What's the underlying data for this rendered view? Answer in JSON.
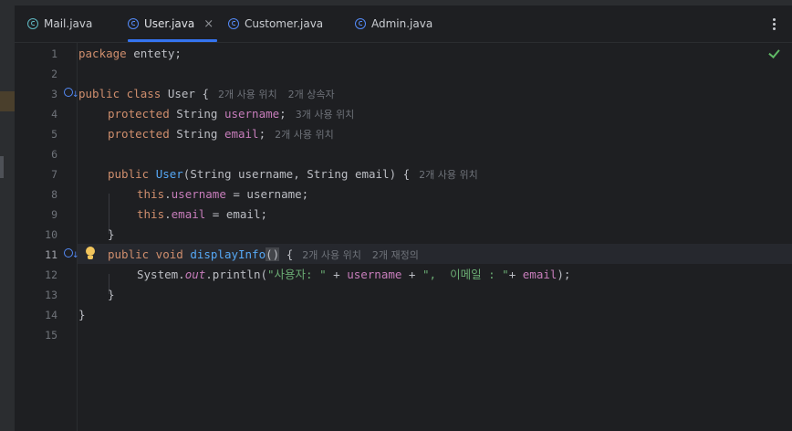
{
  "tabs": [
    {
      "label": "Mail.java",
      "icon": "interface-icon"
    },
    {
      "label": "User.java",
      "icon": "class-icon",
      "active": true,
      "close": "×"
    },
    {
      "label": "Customer.java",
      "icon": "class-icon"
    },
    {
      "label": "Admin.java",
      "icon": "class-icon"
    }
  ],
  "gutter": {
    "line_numbers": [
      "1",
      "2",
      "3",
      "4",
      "5",
      "6",
      "7",
      "8",
      "9",
      "10",
      "11",
      "12",
      "13",
      "14",
      "15"
    ],
    "current_line": "11"
  },
  "code": {
    "l1_kw": "package",
    "l1_rest": " entety;",
    "l3_kw": "public class",
    "l3_name": " User {",
    "l3_hint1": "2개 사용 위치",
    "l3_hint2": "2개 상속자",
    "l4_kw": "protected",
    "l4_type": " String ",
    "l4_field": "username",
    "l4_end": ";",
    "l4_hint": "3개 사용 위치",
    "l5_kw": "protected",
    "l5_type": " String ",
    "l5_field": "email",
    "l5_end": ";",
    "l5_hint": "2개 사용 위치",
    "l7_kw": "public",
    "l7_fn": "User",
    "l7_rest": "(String username, String email) {",
    "l7_hint": "2개 사용 위치",
    "l8_this": "this",
    "l8_dot": ".",
    "l8_field": "username",
    "l8_rest": " = username;",
    "l9_this": "this",
    "l9_dot": ".",
    "l9_field": "email",
    "l9_rest": " = email;",
    "l10": "}",
    "l11_kw": "public void",
    "l11_fn": "displayInfo",
    "l11_paren": "()",
    "l11_rest": " {",
    "l11_hint1": "2개 사용 위치",
    "l11_hint2": "2개 재정의",
    "l12_a": "System.",
    "l12_out": "out",
    "l12_b": ".println(",
    "l12_str1": "\"사용자: \"",
    "l12_c": " + ",
    "l12_field1": "username",
    "l12_d": " + ",
    "l12_str2": "\",  이메일 : \"",
    "l12_e": "+ ",
    "l12_field2": "email",
    "l12_f": ");",
    "l13": "}",
    "l14": "}"
  },
  "status": {
    "inspection_icon": "check-icon",
    "inspection_color": "#5fb865"
  },
  "colors": {
    "background": "#1e1f22",
    "keyword": "#cf8e6d",
    "field": "#c77dbb",
    "function": "#56a8f5",
    "string": "#6aab73",
    "accent": "#3574f0"
  }
}
